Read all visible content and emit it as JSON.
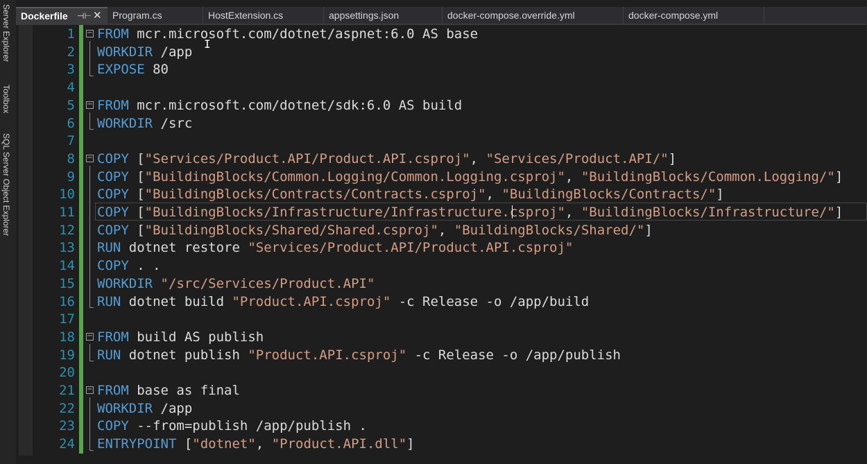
{
  "side_tabs": [
    {
      "label": "Server Explorer"
    },
    {
      "label": "Toolbox"
    },
    {
      "label": "SQL Server Object Explorer"
    }
  ],
  "tabs": [
    {
      "label": "Dockerfile",
      "active": true
    },
    {
      "label": "Program.cs"
    },
    {
      "label": "HostExtension.cs"
    },
    {
      "label": "appsettings.json"
    },
    {
      "label": "docker-compose.override.yml"
    },
    {
      "label": "docker-compose.yml"
    }
  ],
  "icons": {
    "pin": "pin-icon",
    "close": "close-icon",
    "fold": "collapse-icon"
  },
  "colors": {
    "keyword": "#569cd6",
    "string": "#d69d85",
    "line_number": "#2b91af",
    "change_bar": "#57a64a",
    "text": "#dcdcdc"
  },
  "editor": {
    "current_line": 11,
    "lines": [
      {
        "num": "1",
        "fold": "⊟",
        "parts": [
          {
            "t": "kw",
            "v": "FROM"
          },
          {
            "t": "txt",
            "v": " mcr.microsoft.com/dotnet/aspnet:6.0 AS base"
          }
        ]
      },
      {
        "num": "2",
        "parts": [
          {
            "t": "kw",
            "v": "WORKDIR"
          },
          {
            "t": "txt",
            "v": " /app"
          }
        ]
      },
      {
        "num": "3",
        "parts": [
          {
            "t": "kw",
            "v": "EXPOSE"
          },
          {
            "t": "txt",
            "v": " 80"
          }
        ]
      },
      {
        "num": "4",
        "parts": []
      },
      {
        "num": "5",
        "fold": "⊟",
        "parts": [
          {
            "t": "kw",
            "v": "FROM"
          },
          {
            "t": "txt",
            "v": " mcr.microsoft.com/dotnet/sdk:6.0 AS build"
          }
        ]
      },
      {
        "num": "6",
        "parts": [
          {
            "t": "kw",
            "v": "WORKDIR"
          },
          {
            "t": "txt",
            "v": " /src"
          }
        ]
      },
      {
        "num": "7",
        "parts": []
      },
      {
        "num": "8",
        "fold": "⊟",
        "parts": [
          {
            "t": "kw",
            "v": "COPY"
          },
          {
            "t": "txt",
            "v": " ["
          },
          {
            "t": "str",
            "v": "\"Services/Product.API/Product.API.csproj\""
          },
          {
            "t": "txt",
            "v": ", "
          },
          {
            "t": "str",
            "v": "\"Services/Product.API/\""
          },
          {
            "t": "txt",
            "v": "]"
          }
        ]
      },
      {
        "num": "9",
        "parts": [
          {
            "t": "kw",
            "v": "COPY"
          },
          {
            "t": "txt",
            "v": " ["
          },
          {
            "t": "str",
            "v": "\"BuildingBlocks/Common.Logging/Common.Logging.csproj\""
          },
          {
            "t": "txt",
            "v": ", "
          },
          {
            "t": "str",
            "v": "\"BuildingBlocks/Common.Logging/\""
          },
          {
            "t": "txt",
            "v": "]"
          }
        ]
      },
      {
        "num": "10",
        "parts": [
          {
            "t": "kw",
            "v": "COPY"
          },
          {
            "t": "txt",
            "v": " ["
          },
          {
            "t": "str",
            "v": "\"BuildingBlocks/Contracts/Contracts.csproj\""
          },
          {
            "t": "txt",
            "v": ", "
          },
          {
            "t": "str",
            "v": "\"BuildingBlocks/Contracts/\""
          },
          {
            "t": "txt",
            "v": "]"
          }
        ]
      },
      {
        "num": "11",
        "parts": [
          {
            "t": "kw",
            "v": "COPY"
          },
          {
            "t": "txt",
            "v": " ["
          },
          {
            "t": "str",
            "v": "\"BuildingBlocks/Infrastructure/Infrastructure.csproj\""
          },
          {
            "t": "txt",
            "v": ", "
          },
          {
            "t": "str",
            "v": "\"BuildingBlocks/Infrastructure/\""
          },
          {
            "t": "txt",
            "v": "]"
          }
        ]
      },
      {
        "num": "12",
        "parts": [
          {
            "t": "kw",
            "v": "COPY"
          },
          {
            "t": "txt",
            "v": " ["
          },
          {
            "t": "str",
            "v": "\"BuildingBlocks/Shared/Shared.csproj\""
          },
          {
            "t": "txt",
            "v": ", "
          },
          {
            "t": "str",
            "v": "\"BuildingBlocks/Shared/\""
          },
          {
            "t": "txt",
            "v": "]"
          }
        ]
      },
      {
        "num": "13",
        "parts": [
          {
            "t": "kw",
            "v": "RUN"
          },
          {
            "t": "txt",
            "v": " dotnet restore "
          },
          {
            "t": "str",
            "v": "\"Services/Product.API/Product.API.csproj\""
          }
        ]
      },
      {
        "num": "14",
        "parts": [
          {
            "t": "kw",
            "v": "COPY"
          },
          {
            "t": "txt",
            "v": " . ."
          }
        ]
      },
      {
        "num": "15",
        "parts": [
          {
            "t": "kw",
            "v": "WORKDIR"
          },
          {
            "t": "txt",
            "v": " "
          },
          {
            "t": "str",
            "v": "\"/src/Services/Product.API\""
          }
        ]
      },
      {
        "num": "16",
        "parts": [
          {
            "t": "kw",
            "v": "RUN"
          },
          {
            "t": "txt",
            "v": " dotnet build "
          },
          {
            "t": "str",
            "v": "\"Product.API.csproj\""
          },
          {
            "t": "txt",
            "v": " -c Release -o /app/build"
          }
        ]
      },
      {
        "num": "17",
        "parts": []
      },
      {
        "num": "18",
        "fold": "⊟",
        "parts": [
          {
            "t": "kw",
            "v": "FROM"
          },
          {
            "t": "txt",
            "v": " build AS publish"
          }
        ]
      },
      {
        "num": "19",
        "parts": [
          {
            "t": "kw",
            "v": "RUN"
          },
          {
            "t": "txt",
            "v": " dotnet publish "
          },
          {
            "t": "str",
            "v": "\"Product.API.csproj\""
          },
          {
            "t": "txt",
            "v": " -c Release -o /app/publish"
          }
        ]
      },
      {
        "num": "20",
        "parts": []
      },
      {
        "num": "21",
        "fold": "⊟",
        "parts": [
          {
            "t": "kw",
            "v": "FROM"
          },
          {
            "t": "txt",
            "v": " base as final"
          }
        ]
      },
      {
        "num": "22",
        "parts": [
          {
            "t": "kw",
            "v": "WORKDIR"
          },
          {
            "t": "txt",
            "v": " /app"
          }
        ]
      },
      {
        "num": "23",
        "parts": [
          {
            "t": "kw",
            "v": "COPY"
          },
          {
            "t": "txt",
            "v": " --from=publish /app/publish ."
          }
        ]
      },
      {
        "num": "24",
        "parts": [
          {
            "t": "kw",
            "v": "ENTRYPOINT"
          },
          {
            "t": "txt",
            "v": " ["
          },
          {
            "t": "str",
            "v": "\"dotnet\""
          },
          {
            "t": "txt",
            "v": ", "
          },
          {
            "t": "str",
            "v": "\"Product.API.dll\""
          },
          {
            "t": "txt",
            "v": "]"
          }
        ]
      }
    ]
  }
}
